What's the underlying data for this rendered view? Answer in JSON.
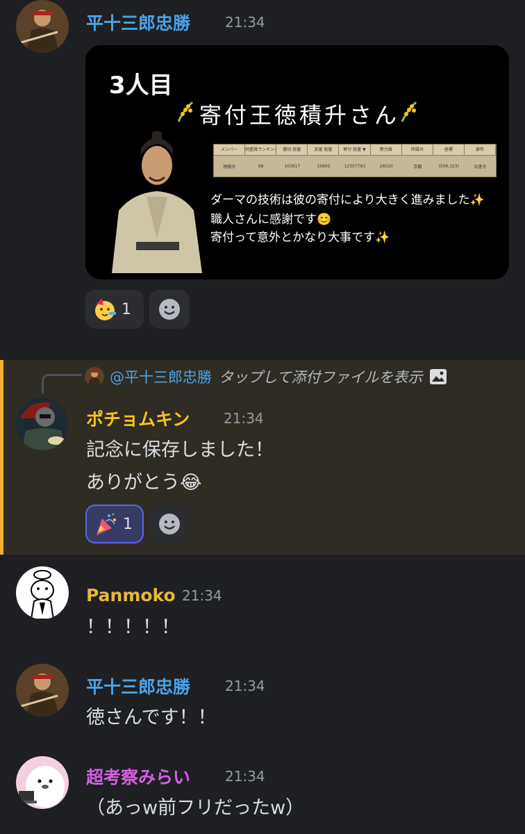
{
  "messages": {
    "m1": {
      "username": "平十三郎忠勝",
      "time": "21:34",
      "username_color": "#4aa3e8",
      "attachment": {
        "heading": "3人目",
        "subtitle": "寄付王徳積升さん",
        "table_headers": [
          "メンバー",
          "同盟員ランキング",
          "戦功 総量",
          "支援 総量",
          "寄付 総量 ▼",
          "勢力値",
          "所属州",
          "座標",
          "操作"
        ],
        "table_row": [
          "徳積升",
          "98",
          "163917",
          "16800",
          "12507783",
          "28020",
          "京都",
          "(506,323)",
          "兵書令"
        ],
        "lines": [
          "ダーマの技術は彼の寄付により大きく進みました✨",
          "職人さんに感謝です😊",
          "寄付って意外とかなり大事です✨"
        ]
      },
      "reaction": {
        "emoji": "partying-face",
        "count": "1"
      }
    },
    "m2": {
      "reply_to": "@平十三郎忠勝",
      "reply_text": "タップして添付ファイルを表示",
      "username": "ポチョムキン",
      "time": "21:34",
      "username_color": "#f7c51e",
      "lines": [
        "記念に保存しました！",
        "ありがとう😂"
      ],
      "reaction": {
        "emoji": "party-popper",
        "count": "1"
      }
    },
    "m3": {
      "username": "Panmoko",
      "time": "21:34",
      "username_color": "#e8b73a",
      "text": "！！！！！"
    },
    "m4": {
      "username": "平十三郎忠勝",
      "time": "21:34",
      "username_color": "#4aa3e8",
      "text": "徳さんです！！"
    },
    "m5": {
      "username": "超考察みらい",
      "time": "21:34",
      "username_color": "#d65ee8",
      "text": "（あっw前フリだったw）"
    }
  }
}
